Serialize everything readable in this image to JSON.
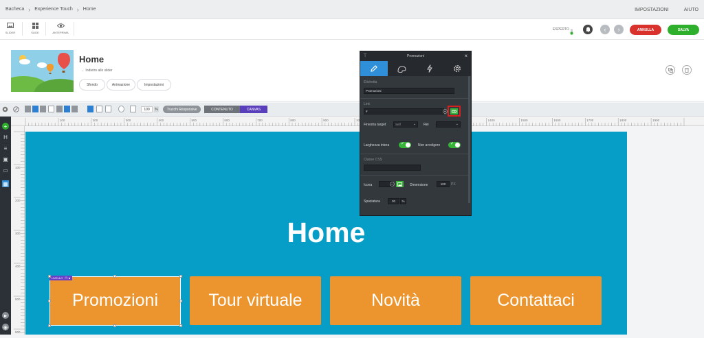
{
  "breadcrumb": [
    "Bacheca",
    "Experience Touch",
    "Home"
  ],
  "top_links": {
    "settings": "IMPOSTAZIONI",
    "help": "AIUTO"
  },
  "toolbar": {
    "slider_label": "SLIDER",
    "slide_label": "SLIDE",
    "preview_label": "ANTEPRIMA",
    "mode_label": "ESPERTO",
    "cancel_label": "ANNULLA",
    "save_label": "SALVA"
  },
  "slide": {
    "title": "Home",
    "back_link": "Indietro allo slider",
    "pills": [
      "Sfondo",
      "Animazione",
      "Impostazioni"
    ]
  },
  "editor": {
    "zoom": "100",
    "zoom_unit": "%",
    "responsive_label": "Trucchi Responsive",
    "content_label": "CONTENUTO",
    "canvas_label": "CANVAS",
    "ruler_top": [
      "100",
      "200",
      "300",
      "400",
      "500",
      "600",
      "700",
      "800",
      "900",
      "1000",
      "1100",
      "1200",
      "1300",
      "1400",
      "1500",
      "1600",
      "1700",
      "1800",
      "1900"
    ],
    "ruler_left": [
      "100",
      "200",
      "300",
      "400",
      "500",
      "600"
    ]
  },
  "canvas": {
    "title": "Home",
    "buttons": [
      "Promozioni",
      "Tour virtuale",
      "Novità",
      "Contattaci"
    ],
    "selected_tag": "LIVELLO"
  },
  "panel": {
    "title": "Promozioni",
    "label_heading": "Etichetta",
    "label_value": "Promozioni",
    "link_heading": "Link",
    "link_value": "#",
    "target_label": "Finestra target",
    "target_value": "Self",
    "rel_label": "Rel",
    "full_width_label": "Larghezza intera",
    "nowrap_label": "Non avvolgere",
    "css_label": "Classe CSS",
    "icon_label": "Icona",
    "size_label": "Dimensione",
    "size_value": "100",
    "size_unit": "PX",
    "spacing_label": "Spaziatura",
    "spacing_value": "30",
    "spacing_unit": "%"
  },
  "colors": {
    "canvas_bg": "#069dc6",
    "button_bg": "#ec952e",
    "cancel": "#d9312c",
    "save": "#2fb02d",
    "accent_blue": "#2f8fd8",
    "canvas_mode": "#5a3fbd"
  }
}
